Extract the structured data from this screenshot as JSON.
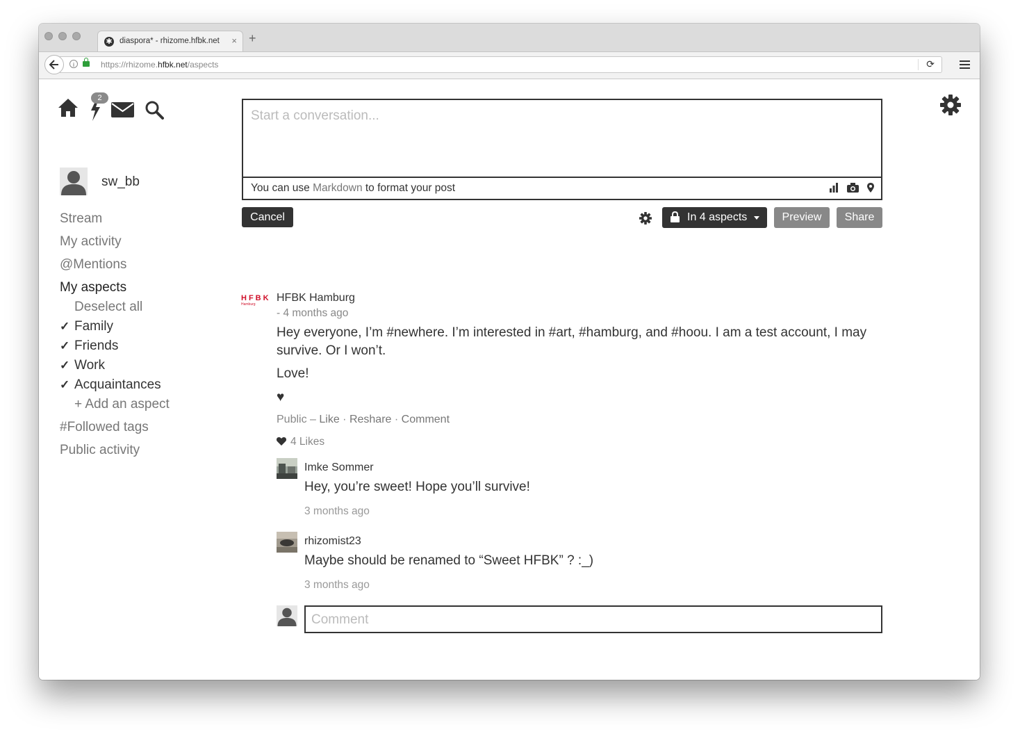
{
  "browser": {
    "tab_title": "diaspora* - rhizome.hfbk.net",
    "tab_close": "×",
    "new_tab": "+",
    "url_prefix": "https://rhizome.",
    "url_domain": "hfbk.net",
    "url_path": "/aspects"
  },
  "header": {
    "notification_count": "2"
  },
  "user": {
    "name": "sw_bb"
  },
  "sidebar": {
    "stream": "Stream",
    "my_activity": "My activity",
    "mentions": "@Mentions",
    "my_aspects": "My aspects",
    "deselect_all": "Deselect all",
    "aspects": [
      "Family",
      "Friends",
      "Work",
      "Acquaintances"
    ],
    "check_glyph": "✓",
    "add_aspect": "+ Add an aspect",
    "followed_tags": "#Followed tags",
    "public_activity": "Public activity"
  },
  "publisher": {
    "placeholder": "Start a conversation...",
    "hint_before": "You can use ",
    "hint_link": "Markdown",
    "hint_after": " to format your post",
    "cancel": "Cancel",
    "aspects_dropdown": "In 4 aspects",
    "preview": "Preview",
    "share": "Share"
  },
  "post": {
    "logo_text": "HFBK",
    "logo_sub": "Hamburg",
    "author": "HFBK Hamburg",
    "time": "- 4 months ago",
    "text": "Hey everyone, I’m #newhere. I’m interested in #art, #hamburg, and #hoou. I am a test account, I may survive. Or I won’t.",
    "line2": "Love!",
    "line3": "♥",
    "visibility": "Public",
    "dash": " – ",
    "like": "Like",
    "reshare": "Reshare",
    "comment": "Comment",
    "dot": " · ",
    "likes": "4 Likes"
  },
  "comments": [
    {
      "author": "Imke Sommer",
      "text": "Hey, you’re sweet! Hope you’ll survive!",
      "time": "3 months ago"
    },
    {
      "author": "rhizomist23",
      "text": "Maybe should be renamed to “Sweet HFBK” ? :_)",
      "time": "3 months ago"
    }
  ],
  "comment_box": {
    "placeholder": "Comment"
  }
}
